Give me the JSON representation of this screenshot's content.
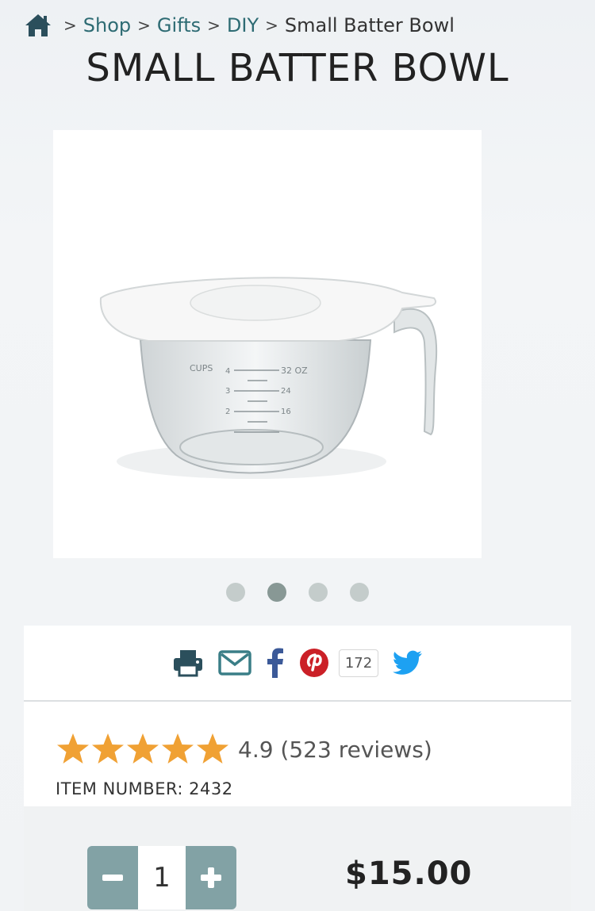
{
  "breadcrumb": {
    "home_icon": "home-icon",
    "separator": ">",
    "items": [
      "Shop",
      "Gifts",
      "DIY"
    ],
    "current": "Small Batter Bowl"
  },
  "product": {
    "title": "SMALL BATTER BOWL",
    "image": {
      "measure_label": "CUPS",
      "cup_marks": [
        "4",
        "3",
        "2"
      ],
      "oz_marks": [
        "32 OZ",
        "24",
        "16"
      ]
    },
    "carousel": {
      "count": 4,
      "active_index": 1
    }
  },
  "share": {
    "icons": [
      "print-icon",
      "email-icon",
      "facebook-icon",
      "pinterest-icon",
      "twitter-icon"
    ],
    "pin_count": "172",
    "colors": {
      "print": "#2b4f5c",
      "email": "#3a7e87",
      "facebook": "#3b5998",
      "pinterest": "#cb2027",
      "twitter": "#1da1f2"
    }
  },
  "rating": {
    "stars": 5,
    "star_color": "#f0a134",
    "text": "4.9 (523 reviews)"
  },
  "item_number": "ITEM NUMBER: 2432",
  "purchase": {
    "quantity": "1",
    "price": "$15.00",
    "stepper_color": "#82a2a5"
  }
}
